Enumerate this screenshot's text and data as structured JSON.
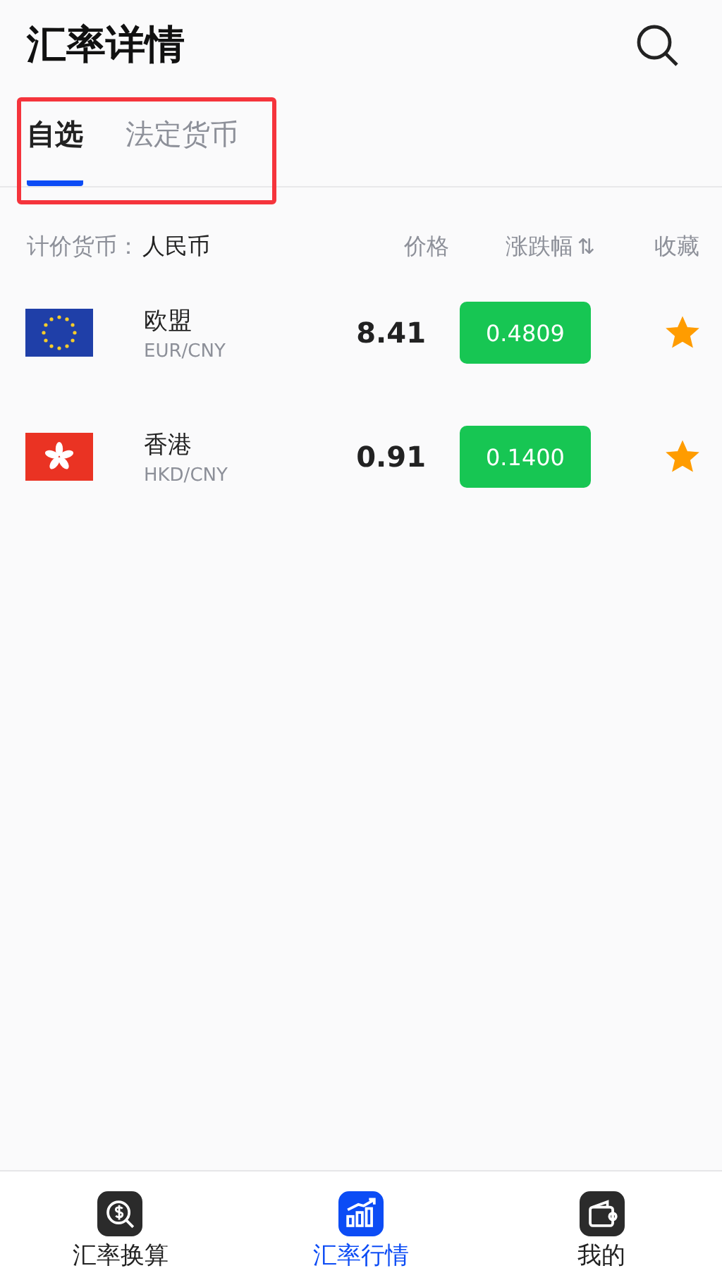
{
  "header": {
    "title": "汇率详情"
  },
  "tabs": [
    {
      "label": "自选",
      "selected": true
    },
    {
      "label": "法定货币",
      "selected": false
    }
  ],
  "columns": {
    "quote_label": "计价货币：",
    "quote_currency": "人民币",
    "price": "价格",
    "change": "涨跌幅",
    "sort": "⇅",
    "favorite": "收藏"
  },
  "rows": [
    {
      "kind": "eu",
      "name": "欧盟",
      "pair": "EUR/CNY",
      "price": "8.41",
      "change": "0.4809",
      "favorite": true
    },
    {
      "kind": "hk",
      "name": "香港",
      "pair": "HKD/CNY",
      "price": "0.91",
      "change": "0.1400",
      "favorite": true
    }
  ],
  "nav": [
    {
      "kind": "converter",
      "label": "汇率换算",
      "selected": false
    },
    {
      "kind": "market",
      "label": "汇率行情",
      "selected": true
    },
    {
      "kind": "wallet",
      "label": "我的",
      "selected": false
    }
  ]
}
